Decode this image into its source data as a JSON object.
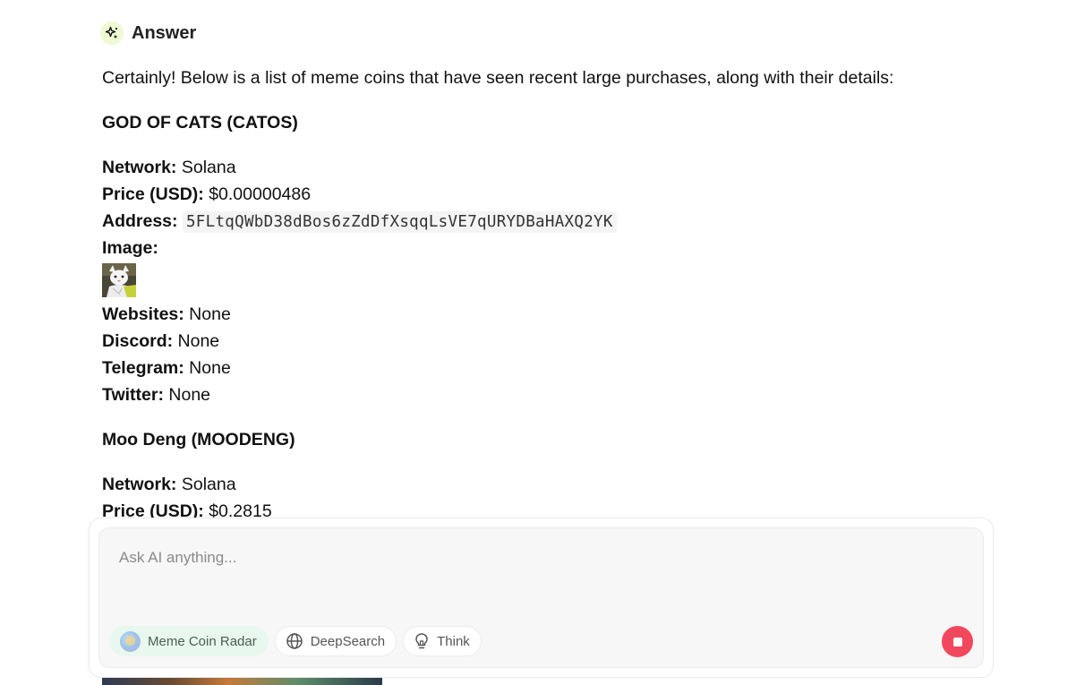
{
  "answer": {
    "title": "Answer",
    "intro": "Certainly! Below is a list of meme coins that have seen recent large purchases, along with their details:"
  },
  "coins": [
    {
      "name": "GOD OF CATS (CATOS)",
      "network_label": "Network:",
      "network": "Solana",
      "price_label": "Price (USD):",
      "price": "$0.00000486",
      "address_label": "Address:",
      "address": "5FLtqQWbD38dBos6zZdDfXsqqLsVE7qURYDBaHAXQ2YK",
      "image_label": "Image:",
      "websites_label": "Websites:",
      "websites": "None",
      "discord_label": "Discord:",
      "discord": "None",
      "telegram_label": "Telegram:",
      "telegram": "None",
      "twitter_label": "Twitter:",
      "twitter": "None"
    },
    {
      "name": "Moo Deng (MOODENG)",
      "network_label": "Network:",
      "network": "Solana",
      "price_label": "Price (USD):",
      "price": "$0.2815"
    }
  ],
  "composer": {
    "placeholder": "Ask AI anything...",
    "chips": [
      {
        "label": "Meme Coin Radar",
        "icon": "meme-coin-radar-avatar",
        "active": true
      },
      {
        "label": "DeepSearch",
        "icon": "globe-icon",
        "active": false
      },
      {
        "label": "Think",
        "icon": "lightbulb-icon",
        "active": false
      }
    ],
    "stop_icon": "stop-icon"
  },
  "colors": {
    "stop_button": "#f2485e",
    "active_chip_bg": "#e9f8ee",
    "answer_icon_bg": "#eefad3"
  }
}
